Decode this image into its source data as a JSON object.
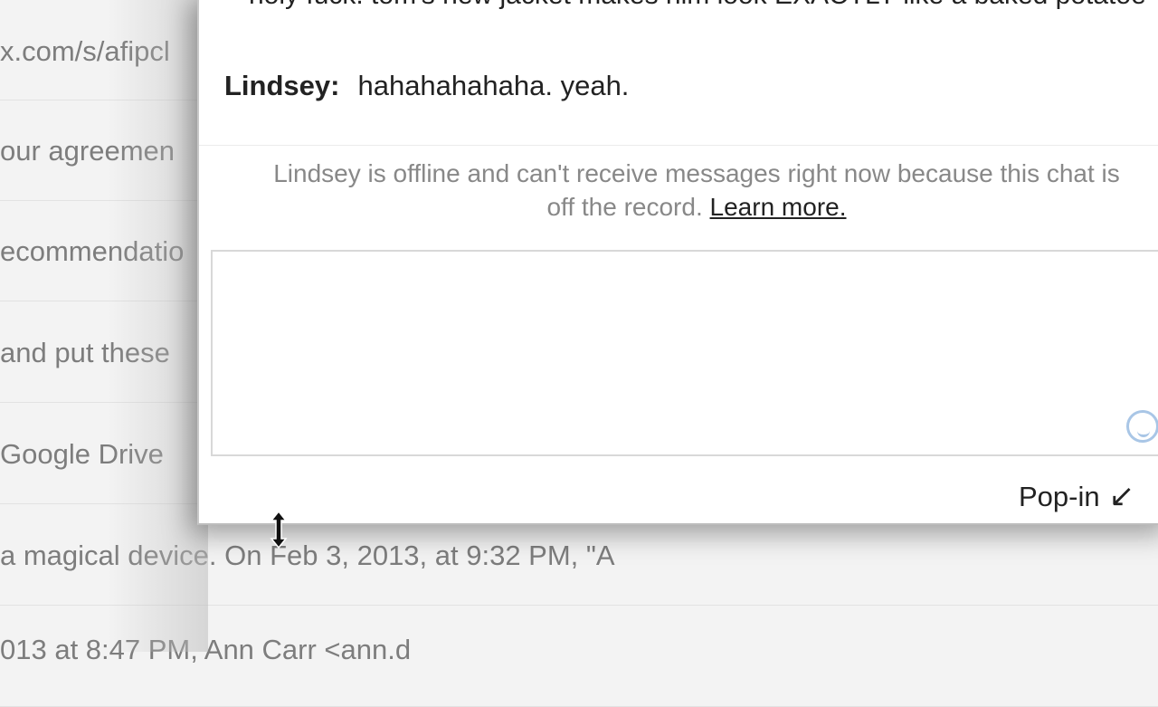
{
  "inbox": {
    "rows": [
      "x.com/s/afipcl",
      "our agreemen",
      "ecommendatio",
      "and put these",
      " Google Drive",
      "a magical device. On Feb 3, 2013, at 9:32 PM, \"A",
      "013 at 8:47 PM, Ann Carr <ann.d"
    ]
  },
  "chat": {
    "message1": "holy fuck. tom's new jacket makes him look EXACTLY like a baked potatoe",
    "message2_sender": "Lindsey:",
    "message2_text": "hahahahahaha. yeah.",
    "offline_line1": "Lindsey is offline and can't receive messages right now because this chat is",
    "offline_line2": "off the record.",
    "learn_more": "Learn more.",
    "input_value": "",
    "emoji_icon": "smiley-icon",
    "popin_label": "Pop-in",
    "popin_arrow": "↙"
  }
}
